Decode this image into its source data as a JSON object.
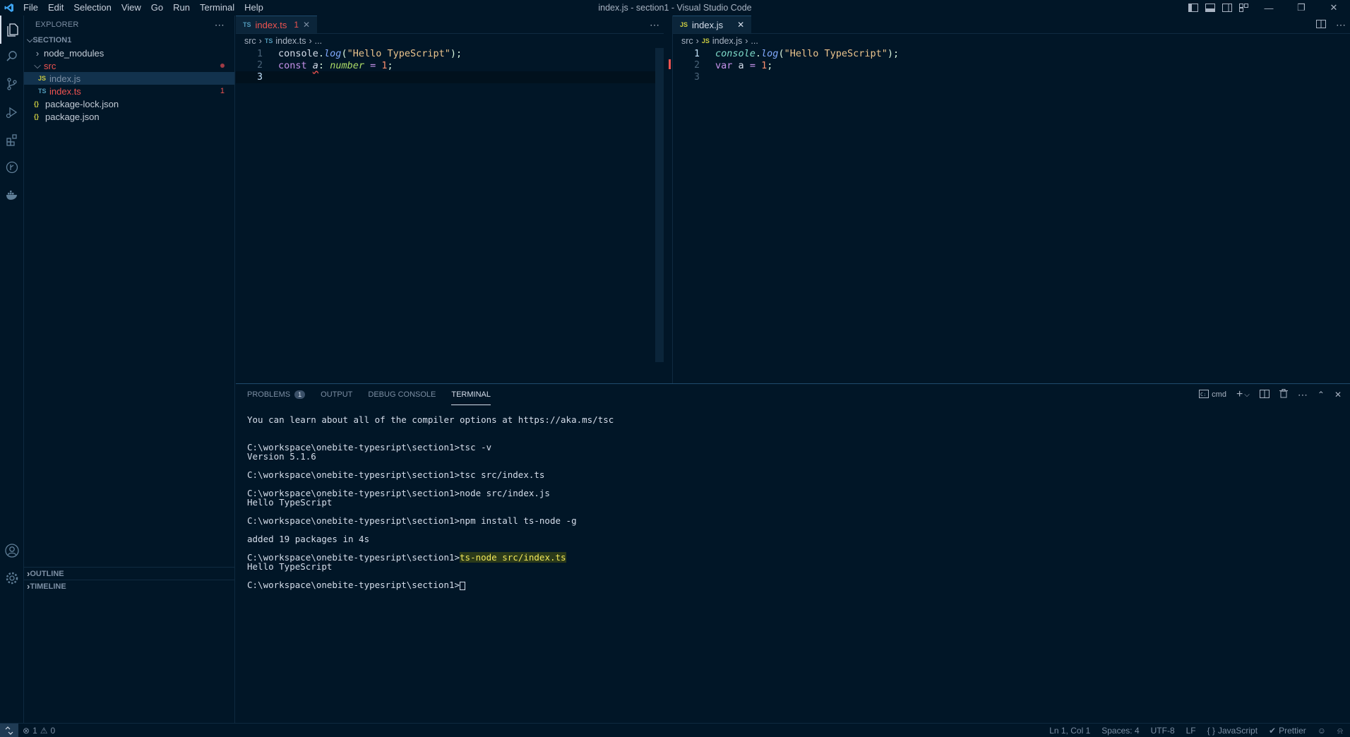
{
  "window": {
    "title": "index.js - section1 - Visual Studio Code",
    "menu": [
      "File",
      "Edit",
      "Selection",
      "View",
      "Go",
      "Run",
      "Terminal",
      "Help"
    ]
  },
  "sidebar": {
    "header": "EXPLORER",
    "section": "SECTION1",
    "tree": [
      {
        "label": "node_modules",
        "type": "folder",
        "expanded": false
      },
      {
        "label": "src",
        "type": "folder",
        "expanded": true
      },
      {
        "label": "index.js",
        "type": "js",
        "icon": "JS"
      },
      {
        "label": "index.ts",
        "type": "ts",
        "icon": "TS",
        "errors": "1"
      },
      {
        "label": "package-lock.json",
        "type": "json",
        "icon": "{}"
      },
      {
        "label": "package.json",
        "type": "json",
        "icon": "{}"
      }
    ],
    "outline": "OUTLINE",
    "timeline": "TIMELINE"
  },
  "editor_left": {
    "tab": {
      "icon": "TS",
      "label": "index.ts",
      "count": "1"
    },
    "breadcrumb": {
      "folder": "src",
      "icon": "TS",
      "file": "index.ts",
      "more": "..."
    },
    "lines": [
      "1",
      "2",
      "3"
    ]
  },
  "editor_right": {
    "tab": {
      "icon": "JS",
      "label": "index.js"
    },
    "breadcrumb": {
      "folder": "src",
      "icon": "JS",
      "file": "index.js",
      "more": "..."
    },
    "lines": [
      "1",
      "2",
      "3"
    ]
  },
  "panel": {
    "tabs": {
      "problems": "PROBLEMS",
      "problems_count": "1",
      "output": "OUTPUT",
      "debug": "DEBUG CONSOLE",
      "terminal": "TERMINAL"
    },
    "shell": "cmd",
    "terminal_lines": [
      "You can learn about all of the compiler options at https://aka.ms/tsc",
      "",
      "",
      "C:\\workspace\\onebite-typesript\\section1>tsc -v",
      "Version 5.1.6",
      "",
      "C:\\workspace\\onebite-typesript\\section1>tsc src/index.ts",
      "",
      "C:\\workspace\\onebite-typesript\\section1>node src/index.js",
      "Hello TypeScript",
      "",
      "C:\\workspace\\onebite-typesript\\section1>npm install ts-node -g",
      "",
      "added 19 packages in 4s",
      "",
      "C:\\workspace\\onebite-typesript\\section1>",
      "Hello TypeScript",
      "",
      "C:\\workspace\\onebite-typesript\\section1>"
    ],
    "highlight_command": "ts-node src/index.ts"
  },
  "statusbar": {
    "errors": "1",
    "warnings": "0",
    "position": "Ln 1, Col 1",
    "spaces": "Spaces: 4",
    "encoding": "UTF-8",
    "eol": "LF",
    "language": "JavaScript",
    "formatter": "Prettier"
  },
  "colors": {
    "background": "#011627",
    "accent": "#1f4b6d",
    "error": "#ef5350",
    "string": "#ecc48d",
    "keyword": "#c792ea",
    "number": "#f78c6c"
  }
}
